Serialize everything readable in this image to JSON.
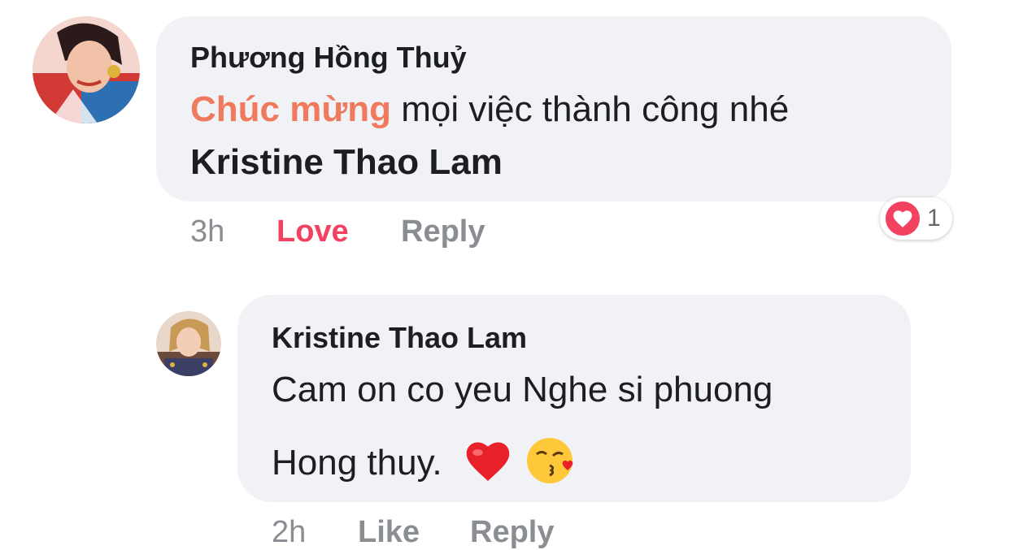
{
  "comment": {
    "author": "Phương Hồng Thuỷ",
    "highlight": "Chúc mừng",
    "text_rest": " mọi việc thành công nhé",
    "mention": "Kristine Thao Lam",
    "time": "3h",
    "love_label": "Love",
    "reply_label": "Reply",
    "reaction": {
      "icon": "heart-icon",
      "count": "1",
      "color": "#f3425f"
    }
  },
  "reply": {
    "author": "Kristine Thao Lam",
    "line1": "Cam on co yeu Nghe si phuong",
    "line2": "Hong thuy.",
    "emojis": [
      "red-heart-icon",
      "kissing-face-icon"
    ],
    "time": "2h",
    "like_label": "Like",
    "reply_label": "Reply"
  },
  "colors": {
    "bubble": "#f0f2f5",
    "highlight": "#f07a5e",
    "love": "#f3425f",
    "secondary": "#8a8d91"
  }
}
